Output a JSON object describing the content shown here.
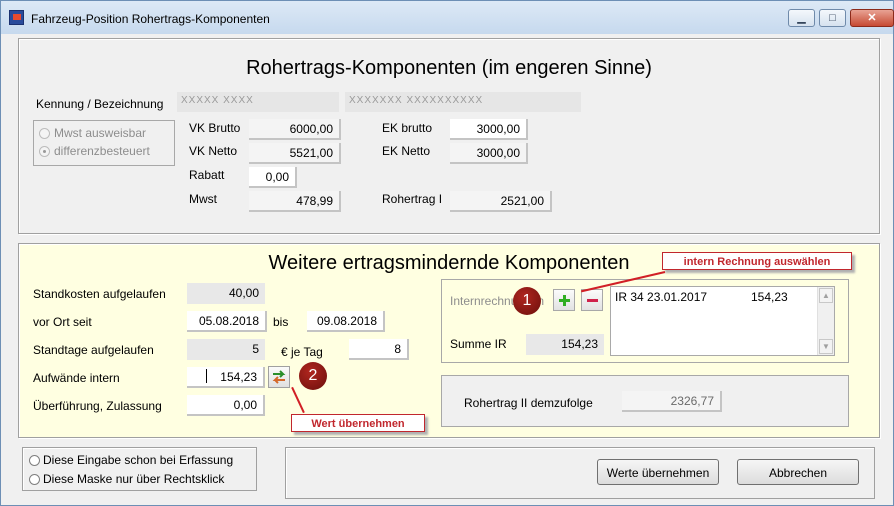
{
  "window": {
    "title": "Fahrzeug-Position Rohertrags-Komponenten"
  },
  "top": {
    "heading": "Rohertrags-Komponenten (im engeren Sinne)",
    "kennung_label": "Kennung / Bezeichnung",
    "kennung_value": "XXXXX XXXX",
    "bezeichnung_value": "XXXXXXX XXXXXXXXXX",
    "vat_options": [
      {
        "label": "Mwst ausweisbar",
        "checked": false
      },
      {
        "label": "differenzbesteuert",
        "checked": true
      }
    ],
    "vk_brutto_label": "VK Brutto",
    "vk_brutto": "6000,00",
    "vk_netto_label": "VK Netto",
    "vk_netto": "5521,00",
    "rabatt_label": "Rabatt",
    "rabatt": "0,00",
    "mwst_label": "Mwst",
    "mwst": "478,99",
    "ek_brutto_label": "EK brutto",
    "ek_brutto": "3000,00",
    "ek_netto_label": "EK Netto",
    "ek_netto": "3000,00",
    "rohertrag1_label": "Rohertrag I",
    "rohertrag1": "2521,00"
  },
  "middle": {
    "heading": "Weitere ertragsmindernde Komponenten",
    "standkosten_label": "Standkosten aufgelaufen",
    "standkosten": "40,00",
    "vor_ort_label": "vor Ort seit",
    "vor_ort_from": "05.08.2018",
    "bis_label": "bis",
    "vor_ort_to": "09.08.2018",
    "standtage_label": "Standtage aufgelaufen",
    "standtage": "5",
    "je_tag_label": "€ je Tag",
    "je_tag": "8",
    "aufwaende_label": "Aufwände intern",
    "aufwaende": "154,23",
    "ueberfuehrung_label": "Überführung, Zulassung",
    "ueberfuehrung": "0,00",
    "internrechnung_label": "Internrechnungen",
    "internrechnung_list": [
      {
        "text": "IR 34 23.01.2017",
        "amount": "154,23"
      }
    ],
    "summe_ir_label": "Summe IR",
    "summe_ir": "154,23",
    "rohertrag2_label": "Rohertrag II demzufolge",
    "rohertrag2": "2326,77"
  },
  "annotations": {
    "callout_select": "intern Rechnung auswählen",
    "callout_apply": "Wert übernehmen",
    "badge1": "1",
    "badge2": "2",
    "color": "#c1272d"
  },
  "bottom": {
    "radio_options": [
      "Diese Eingabe schon bei Erfassung",
      "Diese Maske nur über Rechtsklick"
    ],
    "apply_button": "Werte übernehmen",
    "cancel_button": "Abbrechen"
  }
}
